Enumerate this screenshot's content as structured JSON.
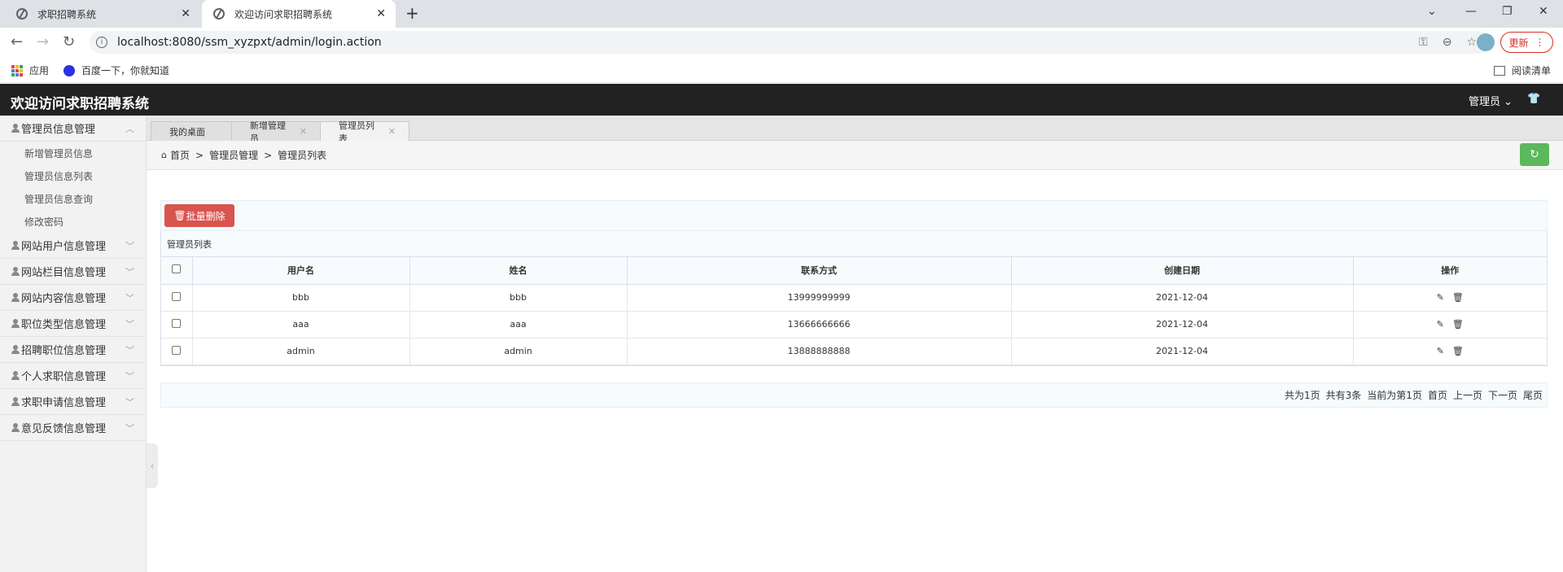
{
  "browser": {
    "tabs": [
      {
        "title": "求职招聘系统"
      },
      {
        "title": "欢迎访问求职招聘系统"
      }
    ],
    "url": "localhost:8080/ssm_xyzpxt/admin/login.action",
    "update_label": "更新",
    "bookmarks": [
      {
        "label": "应用"
      },
      {
        "label": "百度一下，你就知道"
      }
    ],
    "reading_list_label": "阅读清单"
  },
  "header": {
    "title": "欢迎访问求职招聘系统",
    "user_label": "管理员"
  },
  "sidebar": {
    "groups": [
      {
        "label": "管理员信息管理",
        "items": [
          "新增管理员信息",
          "管理员信息列表",
          "管理员信息查询",
          "修改密码"
        ]
      },
      {
        "label": "网站用户信息管理"
      },
      {
        "label": "网站栏目信息管理"
      },
      {
        "label": "网站内容信息管理"
      },
      {
        "label": "职位类型信息管理"
      },
      {
        "label": "招聘职位信息管理"
      },
      {
        "label": "个人求职信息管理"
      },
      {
        "label": "求职申请信息管理"
      },
      {
        "label": "意见反馈信息管理"
      }
    ]
  },
  "pagetabs": [
    {
      "label": "我的桌面"
    },
    {
      "label": "新增管理员"
    },
    {
      "label": "管理员列表"
    }
  ],
  "breadcrumb": [
    "首页",
    "管理员管理",
    "管理员列表"
  ],
  "toolbar": {
    "batch_delete_label": "批量删除"
  },
  "table": {
    "caption": "管理员列表",
    "columns": [
      "用户名",
      "姓名",
      "联系方式",
      "创建日期",
      "操作"
    ],
    "rows": [
      [
        "bbb",
        "bbb",
        "13999999999",
        "2021-12-04"
      ],
      [
        "aaa",
        "aaa",
        "13666666666",
        "2021-12-04"
      ],
      [
        "admin",
        "admin",
        "13888888888",
        "2021-12-04"
      ]
    ]
  },
  "pagination": {
    "total_pages": "共为1页",
    "total_records": "共有3条",
    "current_page": "当前为第1页",
    "first": "首页",
    "prev": "上一页",
    "next": "下一页",
    "last": "尾页"
  },
  "colors": {
    "header_bg": "#222222",
    "danger": "#d9534f",
    "success": "#5cb85c"
  }
}
